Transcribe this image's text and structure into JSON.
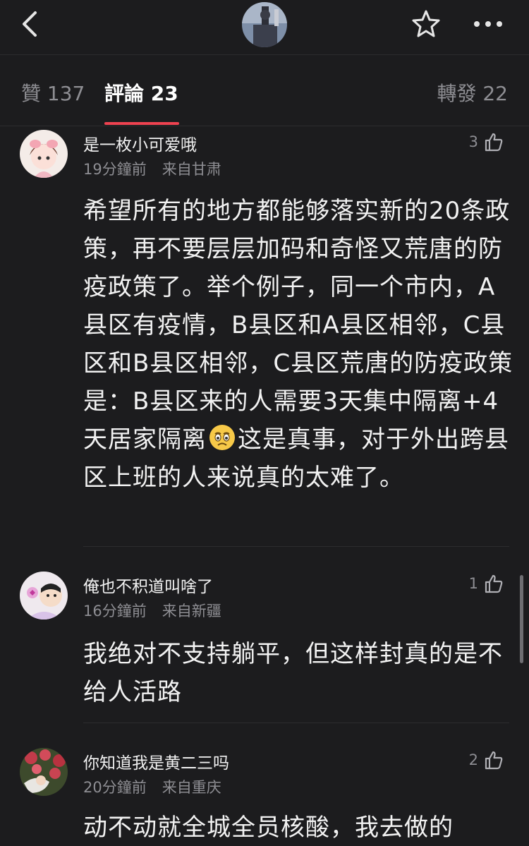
{
  "tabs": {
    "like": "贊 137",
    "comment": "評論 23",
    "repost": "轉發 22"
  },
  "colors": {
    "accent": "#ef4250",
    "background": "#1c1c1e"
  },
  "comments": [
    {
      "name": "是一枚小可爱哦",
      "time": "19分鐘前",
      "location": "来自甘肃",
      "likes": "3",
      "text_before_emoji": "希望所有的地方都能够落实新的20条政策，再不要层层加码和奇怪又荒唐的防疫政策了。举个例子，同一个市内，A县区有疫情，B县区和A县区相邻，C县区和B县区相邻，C县区荒唐的防疫政策是：B县区来的人需要3天集中隔离+4天居家隔离",
      "text_after_emoji": "这是真事，对于外出跨县区上班的人来说真的太难了。",
      "emoji": "crying-face"
    },
    {
      "name": "俺也不积道叫啥了",
      "time": "16分鐘前",
      "location": "来自新疆",
      "likes": "1",
      "text": "我绝对不支持躺平，但这样封真的是不给人活路"
    },
    {
      "name": "你知道我是黄二三吗",
      "time": "20分鐘前",
      "location": "来自重庆",
      "likes": "2",
      "text": "动不动就全城全员核酸，我去做的"
    }
  ],
  "icons": [
    "back-icon",
    "star-icon",
    "more-icon",
    "thumbs-up-icon"
  ]
}
